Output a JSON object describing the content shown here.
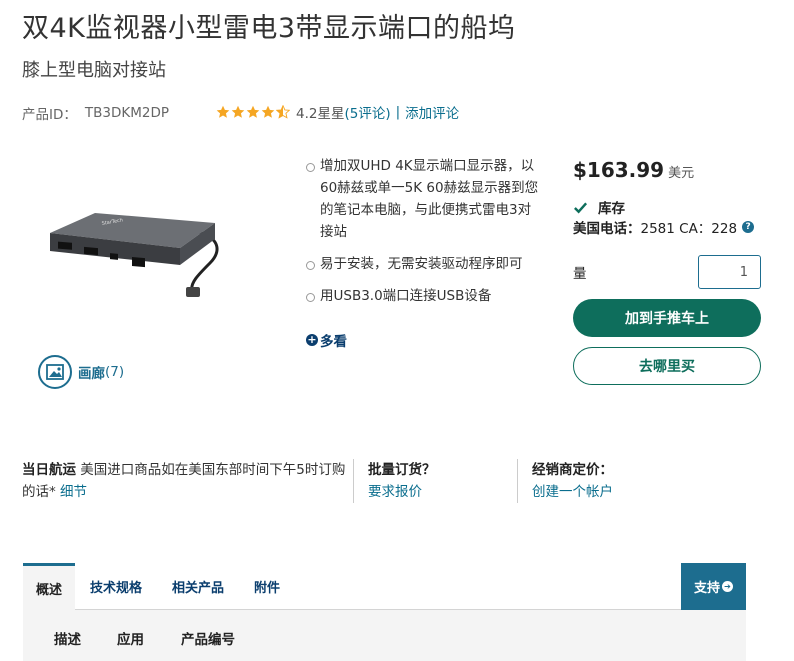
{
  "product": {
    "title": "双4K监视器小型雷电3带显示端口的船坞",
    "subtitle": "膝上型电脑对接站",
    "id_label": "产品ID：",
    "id": "TB3DKM2DP",
    "rating_value": 4.2,
    "rating_text": "4.2星星",
    "reviews_text": "(5评论)",
    "add_review": "添加评论"
  },
  "gallery": {
    "label": "画廊",
    "count": "(7)"
  },
  "features": [
    "增加双UHD 4K显示端口显示器，以60赫兹或单一5K 60赫兹显示器到您的笔记本电脑，与此便携式雷电3对接站",
    "易于安装，无需安装驱动程序即可",
    "用USB3.0端口连接USB设备"
  ],
  "more_label": "多看",
  "purchase": {
    "price": "$163.99",
    "currency": "美元",
    "stock": "库存",
    "phone_label": "美国电话：",
    "phone_value": "2581 CA：228",
    "qty_label": "量",
    "qty_value": "1",
    "add_to_cart": "加到手推车上",
    "where_to_buy": "去哪里买"
  },
  "info": {
    "shipping_head": "当日航运",
    "shipping_text": "美国进口商品如在美国东部时间下午5时订购的话*",
    "shipping_link": "细节",
    "bulk_head": "批量订货？",
    "bulk_link": "要求报价",
    "reseller_head": "经销商定价：",
    "reseller_link": "创建一个帐户"
  },
  "tabs": {
    "items": [
      "概述",
      "技术规格",
      "相关产品",
      "附件"
    ],
    "support": "支持",
    "subtabs": [
      "描述",
      "应用",
      "产品编号"
    ]
  },
  "colors": {
    "accent": "#1d6d8f",
    "button_green": "#0e6e5c",
    "star": "#f5a623"
  },
  "icons": {
    "stars": "star-icon",
    "gallery": "image-icon",
    "more": "plus-circle-icon",
    "stock": "check-icon",
    "help": "question-circle-icon",
    "support": "arrow-circle-icon"
  }
}
